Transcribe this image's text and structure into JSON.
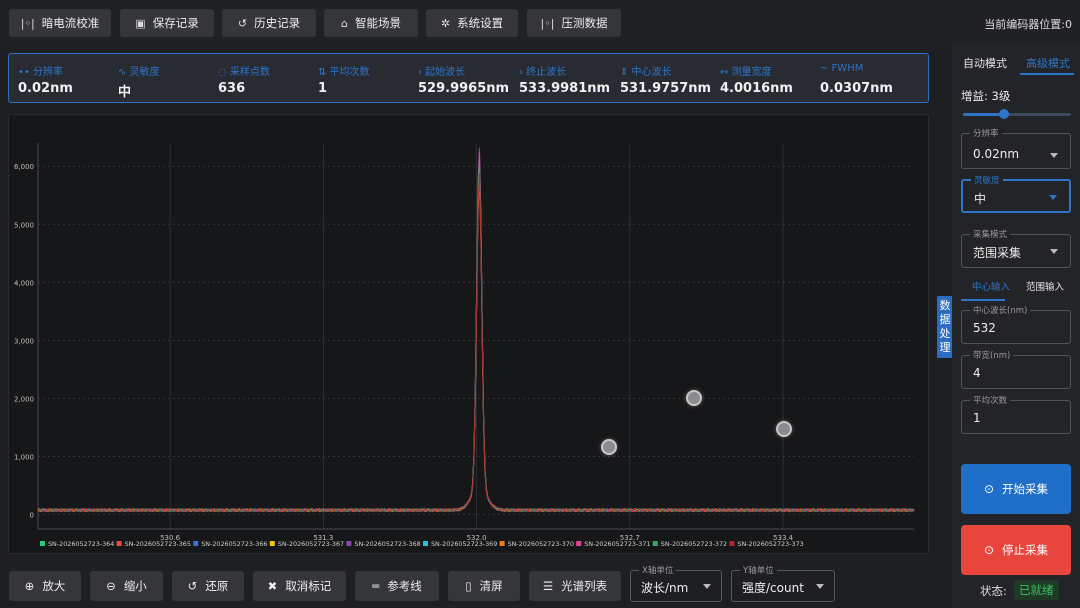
{
  "toolbar": {
    "buttons": [
      {
        "label": "暗电流校准",
        "icon": "bars-icon",
        "glyph": "|◦|"
      },
      {
        "label": "保存记录",
        "icon": "save-icon",
        "glyph": "▣"
      },
      {
        "label": "历史记录",
        "icon": "history-icon",
        "glyph": "↺"
      },
      {
        "label": "智能场景",
        "icon": "scene-icon",
        "glyph": "⌂"
      },
      {
        "label": "系统设置",
        "icon": "gear-icon",
        "glyph": "✲"
      },
      {
        "label": "压测数据",
        "icon": "bars-icon",
        "glyph": "|◦|"
      }
    ],
    "encoder": "当前编码器位置:0"
  },
  "stats": [
    {
      "label": "•• 分辨率",
      "value": "0.02nm"
    },
    {
      "label": "∿ 灵敏度",
      "value": "中"
    },
    {
      "label": "◌ 采样点数",
      "value": "636"
    },
    {
      "label": "⇅ 平均次数",
      "value": "1"
    },
    {
      "label": "‹ 起始波长",
      "value": "529.9965nm"
    },
    {
      "label": "› 终止波长",
      "value": "533.9981nm"
    },
    {
      "label": "⇕ 中心波长",
      "value": "531.9757nm"
    },
    {
      "label": "↔ 测量宽度",
      "value": "4.0016nm"
    },
    {
      "label": "∼ FWHM",
      "value": "0.0307nm"
    }
  ],
  "chart_data": {
    "type": "line",
    "x_ticks": [
      "530.6",
      "531.3",
      "532.0",
      "532.7",
      "533.4"
    ],
    "y_ticks": [
      "0",
      "1,000",
      "2,000",
      "3,000",
      "4,000",
      "5,000",
      "6,000"
    ],
    "xlim": [
      529.9965,
      533.9981
    ],
    "ylim": [
      -250,
      6400
    ],
    "series": [
      {
        "name": "SN-2026052723-364",
        "color": "#2ecc71",
        "peak": 5700
      },
      {
        "name": "SN-2026052723-365",
        "color": "#e74c3c",
        "peak": 5350
      },
      {
        "name": "SN-2026052723-366",
        "color": "#3b6fd8",
        "peak": 5500
      },
      {
        "name": "SN-2026052723-367",
        "color": "#f1c40f",
        "peak": 5600
      },
      {
        "name": "SN-2026052723-368",
        "color": "#8e44ad",
        "peak": 5900
      },
      {
        "name": "SN-2026052723-369",
        "color": "#22c3d8",
        "peak": 5750
      },
      {
        "name": "SN-2026052723-370",
        "color": "#e67e22",
        "peak": 5300
      },
      {
        "name": "SN-2026052723-371",
        "color": "#e84393",
        "peak": 5800
      },
      {
        "name": "SN-2026052723-372",
        "color": "#27ae60",
        "peak": 5650
      },
      {
        "name": "SN-2026052723-373",
        "color": "#b0252a",
        "peak": 5450
      }
    ]
  },
  "bottom": {
    "buttons": [
      {
        "label": "放大",
        "icon": "zoom-in-icon",
        "glyph": "⊕"
      },
      {
        "label": "缩小",
        "icon": "zoom-out-icon",
        "glyph": "⊖"
      },
      {
        "label": "还原",
        "icon": "reset-icon",
        "glyph": "↺"
      },
      {
        "label": "取消标记",
        "icon": "close-icon",
        "glyph": "✖"
      },
      {
        "label": "参考线",
        "icon": "lines-icon",
        "glyph": "═"
      },
      {
        "label": "清屏",
        "icon": "trash-icon",
        "glyph": "▯"
      },
      {
        "label": "光谱列表",
        "icon": "list-icon",
        "glyph": "☰"
      }
    ],
    "x_unit": {
      "label": "X轴单位",
      "value": "波长/nm"
    },
    "y_unit": {
      "label": "Y轴单位",
      "value": "强度/count"
    }
  },
  "side": {
    "tab_label": "数据处理",
    "tabs": [
      "自动模式",
      "高级模式"
    ],
    "gain_label": "增益: 3级",
    "gain_level": 0.38,
    "resolution": {
      "label": "分辨率",
      "value": "0.02nm"
    },
    "sensitivity": {
      "label": "灵敏度",
      "value": "中"
    },
    "mode": {
      "label": "采集模式",
      "value": "范围采集"
    },
    "subtabs": [
      "中心输入",
      "范围输入"
    ],
    "center": {
      "label": "中心波长(nm)",
      "value": "532"
    },
    "width": {
      "label": "带宽(nm)",
      "value": "4"
    },
    "avg": {
      "label": "平均次数",
      "value": "1"
    },
    "start_label": "开始采集",
    "stop_label": "停止采集",
    "status_label": "状态:",
    "status_value": "已就绪",
    "colors": {
      "accent": "#2f74c9",
      "start": "#1f6fc8",
      "stop": "#e8453c",
      "ok": "#3cbf5e"
    }
  }
}
